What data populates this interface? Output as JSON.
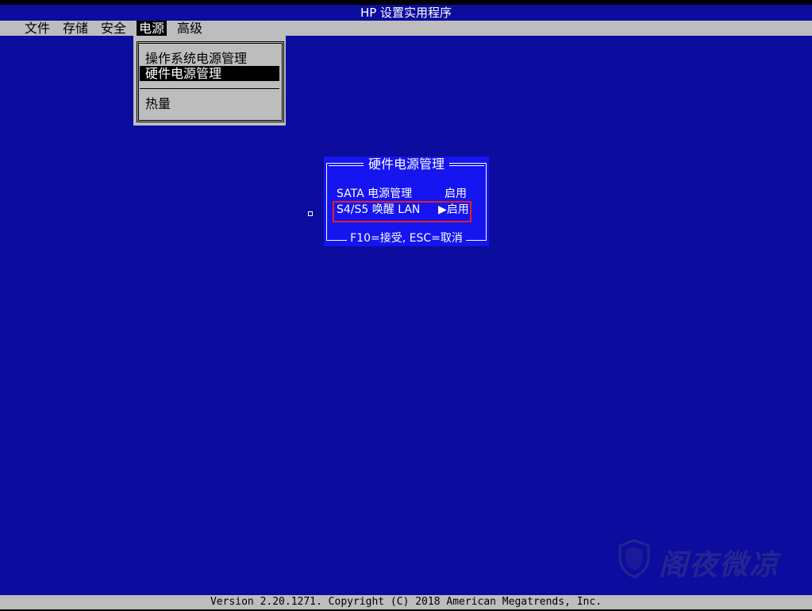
{
  "window": {
    "title": "HP 设置实用程序"
  },
  "menu": {
    "items": [
      {
        "label": "文件"
      },
      {
        "label": "存储"
      },
      {
        "label": "安全"
      },
      {
        "label": "电源",
        "active": true
      },
      {
        "label": "高级"
      }
    ]
  },
  "dropdown": {
    "items": [
      {
        "label": "操作系统电源管理"
      },
      {
        "label": "硬件电源管理",
        "selected": true
      },
      {
        "label": "热量"
      }
    ]
  },
  "dialog": {
    "title": "硬件电源管理",
    "rows": [
      {
        "label": "SATA 电源管理",
        "value": "启用"
      },
      {
        "label": "S4/S5 唤醒 LAN",
        "value": "▶启用",
        "highlighted": true
      }
    ],
    "footer": "F10=接受, ESC=取消"
  },
  "status": {
    "text": "Version 2.20.1271. Copyright (C) 2018 American Megatrends, Inc."
  },
  "watermark": {
    "text": "阁夜微凉",
    "icon": "shield-icon"
  },
  "colors": {
    "background": "#0c0c9e",
    "menu_bar": "#bdbdbd",
    "dialog": "#1515f0",
    "highlight_border": "#e02020"
  }
}
